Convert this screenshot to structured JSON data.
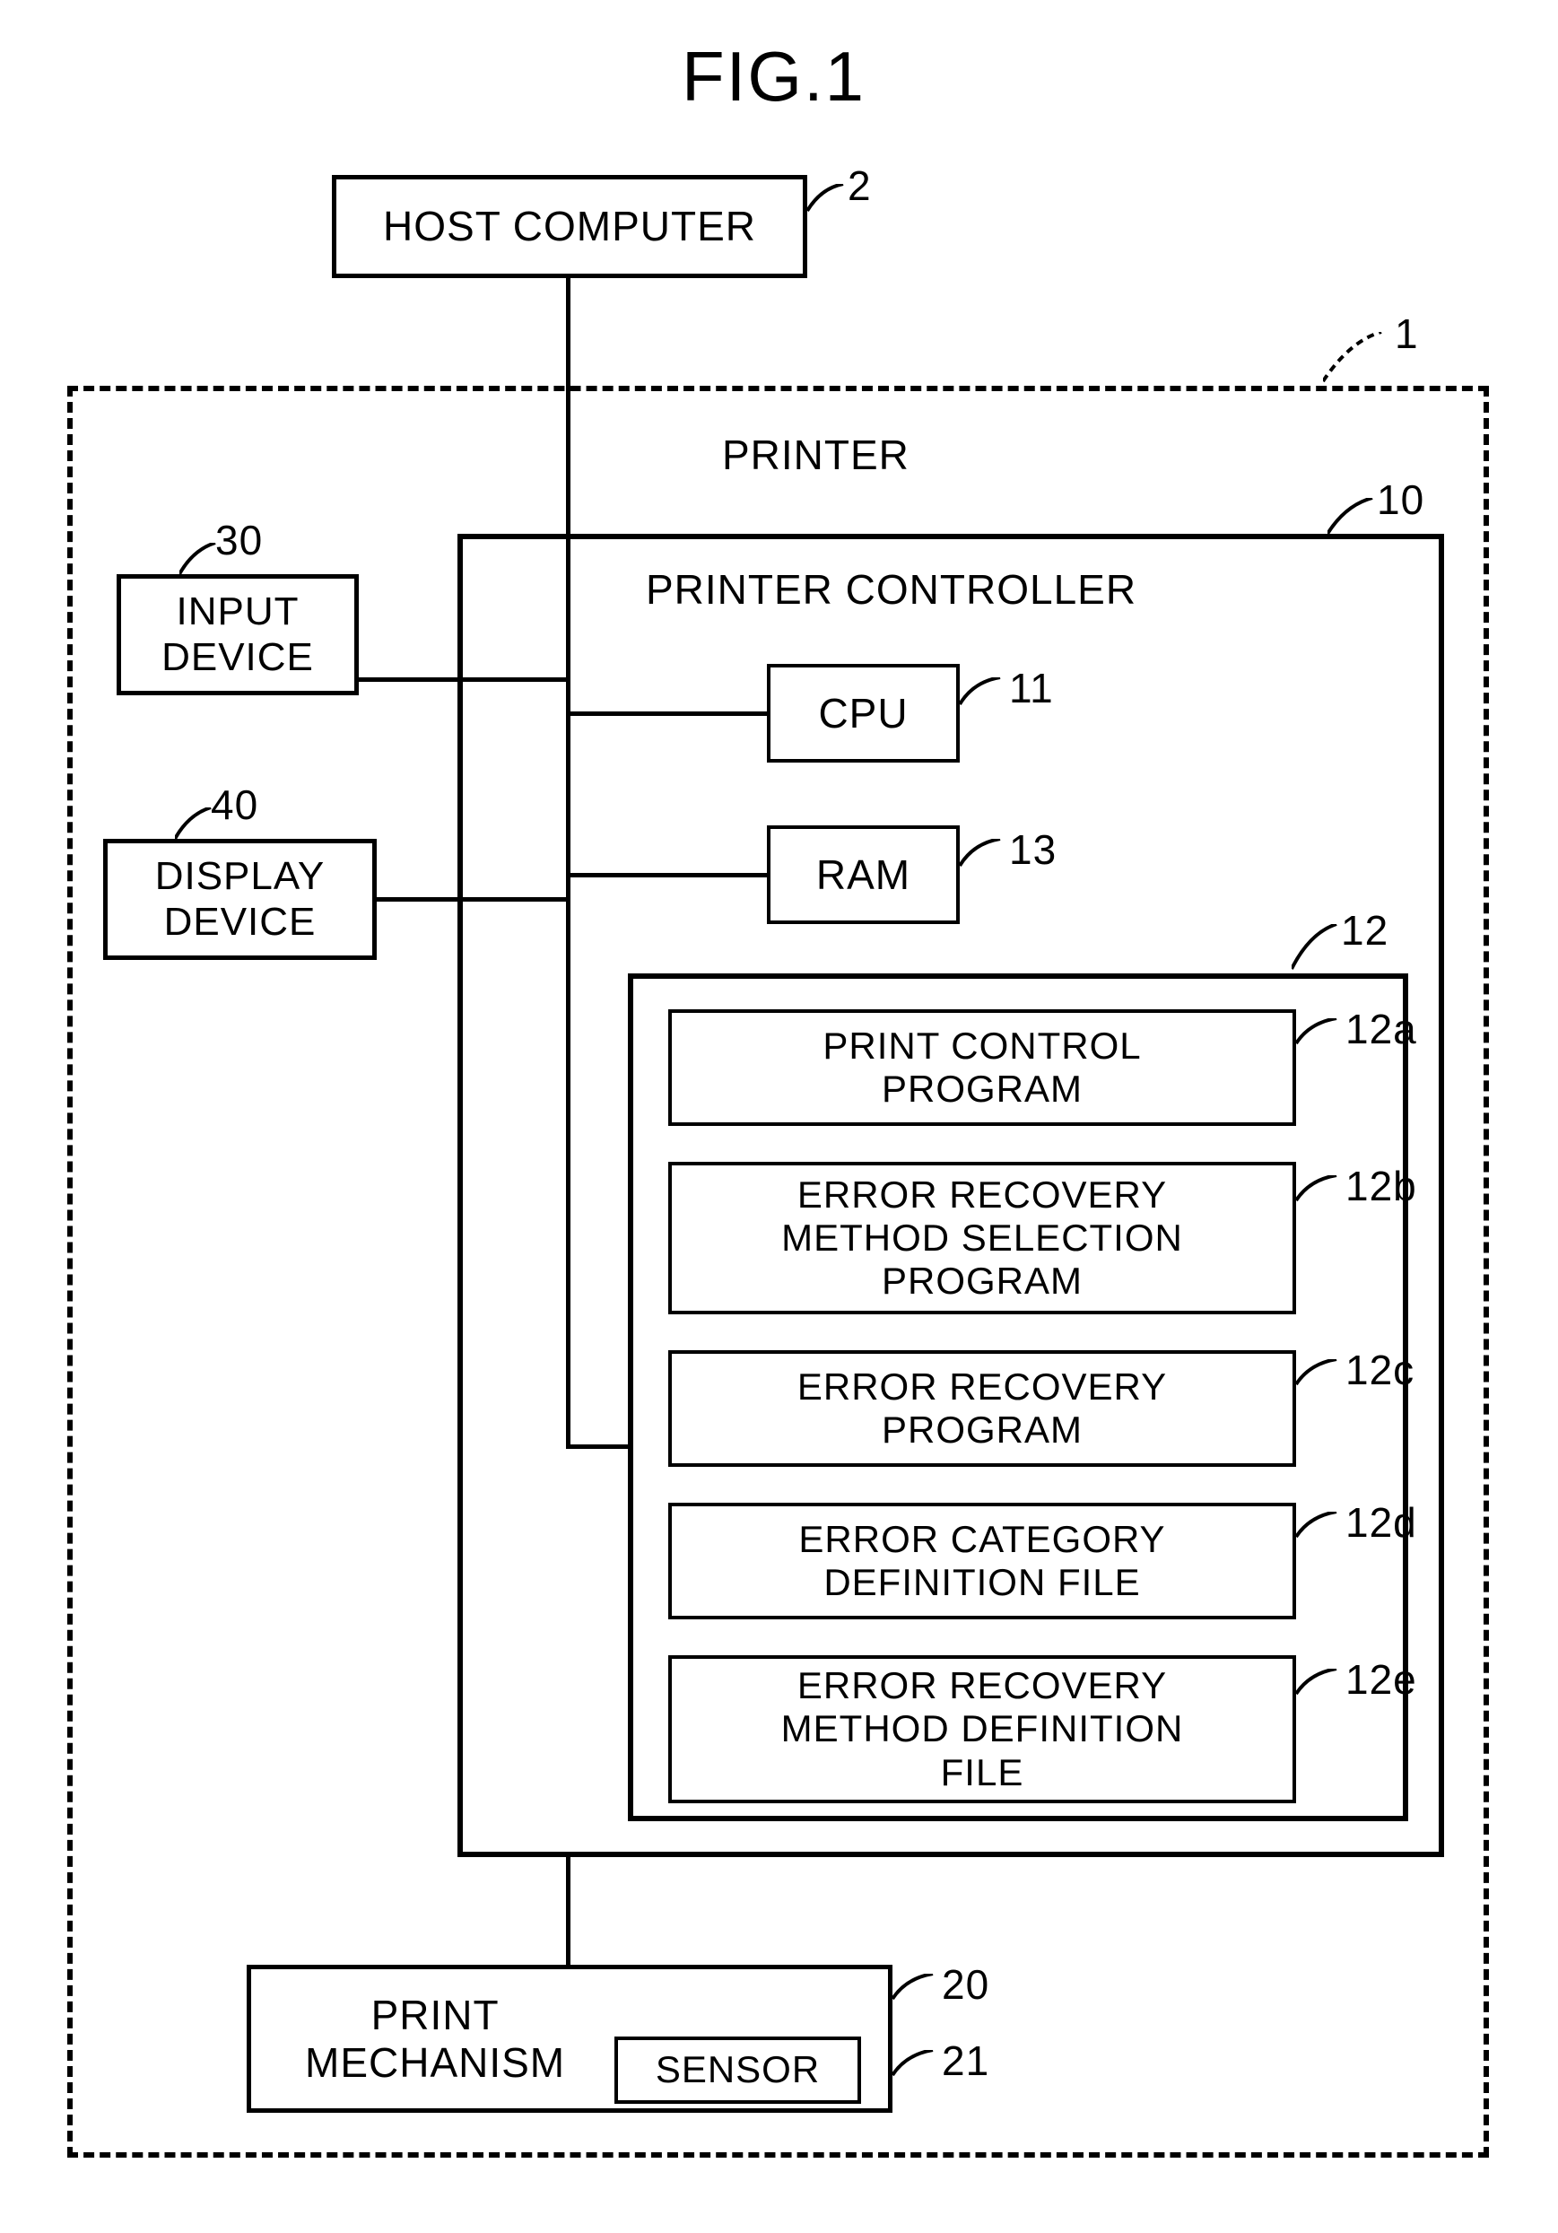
{
  "figure_title": "FIG.1",
  "host_computer": {
    "label": "HOST COMPUTER",
    "ref": "2"
  },
  "printer": {
    "label": "PRINTER",
    "ref": "1"
  },
  "input_device": {
    "label": "INPUT\nDEVICE",
    "ref": "30"
  },
  "display_device": {
    "label": "DISPLAY\nDEVICE",
    "ref": "40"
  },
  "printer_controller": {
    "label": "PRINTER CONTROLLER",
    "ref": "10"
  },
  "cpu": {
    "label": "CPU",
    "ref": "11"
  },
  "ram": {
    "label": "RAM",
    "ref": "13"
  },
  "memory_block": {
    "ref": "12"
  },
  "items": {
    "a": {
      "label": "PRINT CONTROL\nPROGRAM",
      "ref": "12a"
    },
    "b": {
      "label": "ERROR RECOVERY\nMETHOD SELECTION\nPROGRAM",
      "ref": "12b"
    },
    "c": {
      "label": "ERROR RECOVERY\nPROGRAM",
      "ref": "12c"
    },
    "d": {
      "label": "ERROR CATEGORY\nDEFINITION FILE",
      "ref": "12d"
    },
    "e": {
      "label": "ERROR RECOVERY\nMETHOD DEFINITION\nFILE",
      "ref": "12e"
    }
  },
  "print_mechanism": {
    "label": "PRINT\nMECHANISM",
    "ref": "20"
  },
  "sensor": {
    "label": "SENSOR",
    "ref": "21"
  }
}
